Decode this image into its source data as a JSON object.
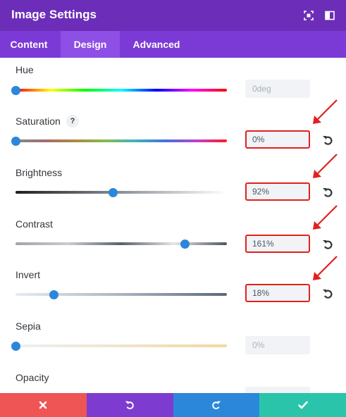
{
  "header": {
    "title": "Image Settings"
  },
  "tabs": [
    {
      "label": "Content",
      "active": false
    },
    {
      "label": "Design",
      "active": true
    },
    {
      "label": "Advanced",
      "active": false
    }
  ],
  "settings": {
    "hue": {
      "label": "Hue",
      "value": "0deg",
      "level": 0.0
    },
    "saturation": {
      "label": "Saturation",
      "help": "?",
      "value": "0%",
      "level": 0.0
    },
    "brightness": {
      "label": "Brightness",
      "value": "92%",
      "level": 0.46
    },
    "contrast": {
      "label": "Contrast",
      "value": "161%",
      "level": 0.8
    },
    "invert": {
      "label": "Invert",
      "value": "18%",
      "level": 0.18
    },
    "sepia": {
      "label": "Sepia",
      "value": "0%",
      "level": 0.0
    },
    "opacity": {
      "label": "Opacity"
    }
  },
  "icons": {
    "header": [
      "expand-icon",
      "sidebar-toggle-icon"
    ],
    "reset": "undo-icon",
    "footer": [
      "close-icon",
      "undo-icon",
      "redo-icon",
      "check-icon"
    ]
  },
  "colors": {
    "header": "#6c2eb9",
    "tabs": "#7b3ad6",
    "accent": "#2b87da",
    "highlight": "#e0211f",
    "cancel": "#ef5555",
    "undo": "#7e3bd0",
    "redo": "#2b87da",
    "save": "#29c4a9"
  }
}
